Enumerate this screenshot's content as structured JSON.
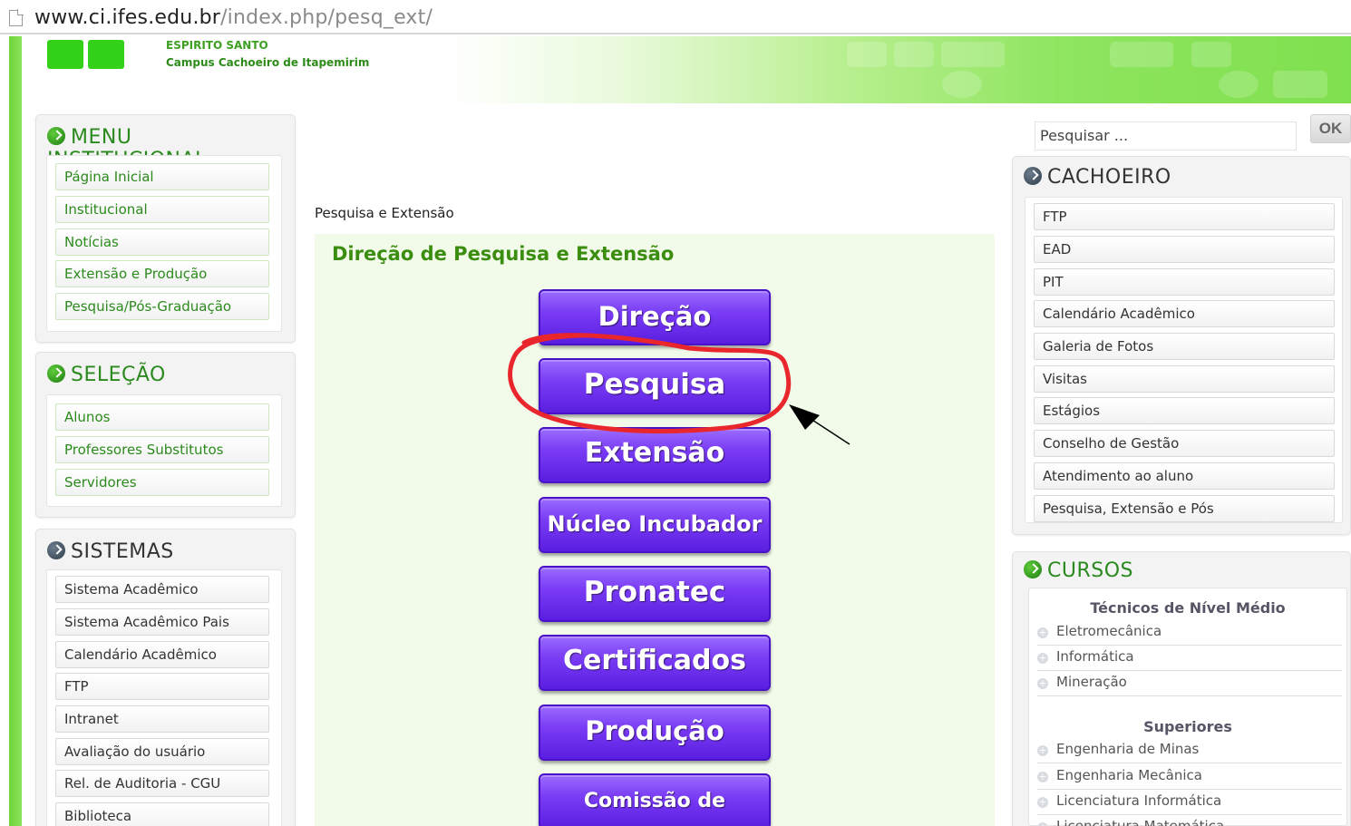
{
  "browser": {
    "url_host": "www.ci.ifes.edu.br",
    "url_path": "/index.php/pesq_ext/"
  },
  "banner": {
    "line1": "ESPIRITO SANTO",
    "line2": "Campus Cachoeiro de Itapemirim"
  },
  "menu_institucional": {
    "title": "MENU INSTITUCIONAL",
    "items": [
      "Página Inicial",
      "Institucional",
      "Notícias",
      "Extensão e Produção",
      "Pesquisa/Pós-Graduação"
    ]
  },
  "selecao": {
    "title": "SELEÇÃO",
    "items": [
      "Alunos",
      "Professores Substitutos",
      "Servidores"
    ]
  },
  "sistemas": {
    "title": "SISTEMAS",
    "items": [
      "Sistema Acadêmico",
      "Sistema Acadêmico Pais",
      "Calendário Acadêmico",
      "FTP",
      "Intranet",
      "Avaliação do usuário",
      "Rel. de Auditoria - CGU",
      "Biblioteca"
    ]
  },
  "main": {
    "breadcrumb": "Pesquisa e Extensão",
    "title": "Direção de Pesquisa e Extensão",
    "buttons": [
      "Direção",
      "Pesquisa",
      "Extensão",
      "Núcleo Incubador",
      "Pronatec",
      "Certificados",
      "Produção",
      "Comissão de Projetos"
    ]
  },
  "search": {
    "placeholder": "Pesquisar ...",
    "ok_label": "OK"
  },
  "cachoeiro": {
    "title": "CACHOEIRO",
    "items": [
      "FTP",
      "EAD",
      "PIT",
      "Calendário Acadêmico",
      "Galeria de Fotos",
      "Visitas",
      "Estágios",
      "Conselho de Gestão",
      "Atendimento ao aluno",
      "Pesquisa, Extensão e Pós"
    ]
  },
  "cursos": {
    "title": "CURSOS",
    "tecnicos_title": "Técnicos de Nível Médio",
    "tecnicos": [
      "Eletromecânica",
      "Informática",
      "Mineração"
    ],
    "superiores_title": "Superiores",
    "superiores": [
      "Engenharia de Minas",
      "Engenharia Mecânica",
      "Licenciatura Informática",
      "Licenciatura Matemática"
    ]
  },
  "colors": {
    "green_text": "#2b8a1e",
    "purple_button": "#6a2cf0",
    "annotation_red": "#e8262c"
  },
  "icons": [
    "page-icon",
    "arrow-bullet-icon",
    "plus-icon"
  ]
}
